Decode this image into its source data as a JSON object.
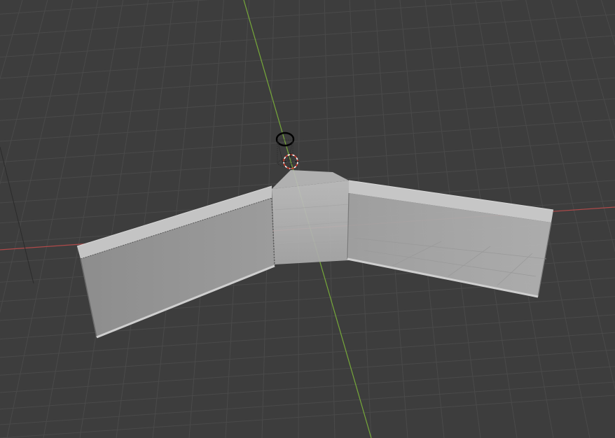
{
  "viewport": {
    "view_mode": "perspective",
    "shading": "solid",
    "grid_visible": true,
    "scene_objects": [
      "wall-left",
      "wall-right",
      "floor-wedge",
      "cylinder-object",
      "3d-cursor"
    ]
  },
  "colors": {
    "background": "#3d3d3d",
    "grid_line": "#4a4a4a",
    "x_axis": "#b04a4a",
    "y_axis": "#76a83a",
    "mesh_face": "#9a9a9a",
    "mesh_face_light": "#b3b3b3",
    "mesh_top": "#c8c8c8",
    "mesh_edge": "#d0d0d0",
    "selected_outline": "#000000",
    "cursor_red": "#d03a2a",
    "cursor_white": "#ffffff"
  },
  "icons": {
    "cursor": "3d-cursor-icon",
    "object": "cylinder-object-icon"
  }
}
